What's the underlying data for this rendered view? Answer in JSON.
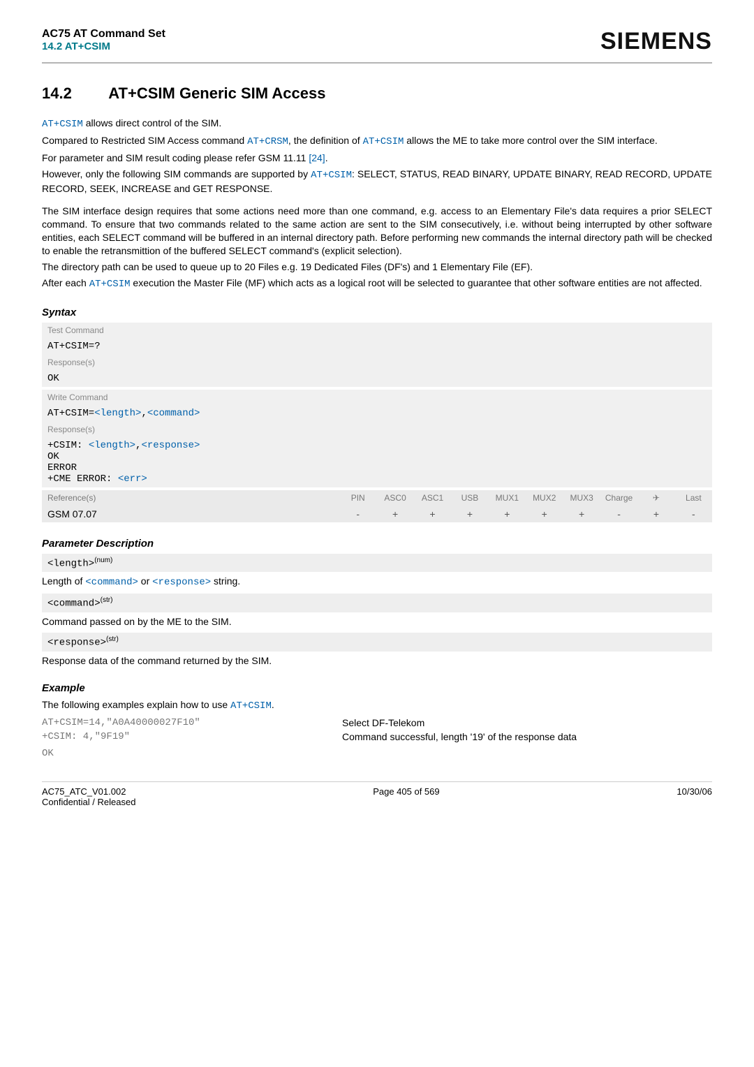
{
  "header": {
    "title": "AC75 AT Command Set",
    "subtitle": "14.2 AT+CSIM",
    "brand": "SIEMENS"
  },
  "section": {
    "number": "14.2",
    "title": "AT+CSIM   Generic SIM Access"
  },
  "intro": {
    "p1_a": "AT+CSIM",
    "p1_b": " allows direct control of the SIM.",
    "p2_a": "Compared to Restricted SIM Access command ",
    "p2_b": "AT+CRSM",
    "p2_c": ", the definition of ",
    "p2_d": "AT+CSIM",
    "p2_e": " allows the ME to take more control over the SIM interface.",
    "p3_a": "For parameter and SIM result coding please refer GSM 11.11 ",
    "p3_b": "[24]",
    "p3_c": ".",
    "p4_a": "However, only the following SIM commands are supported by ",
    "p4_b": "AT+CSIM",
    "p4_c": ": SELECT, STATUS, READ BINARY, UPDATE BINARY, READ RECORD, UPDATE RECORD, SEEK, INCREASE and GET RESPONSE.",
    "p5": "The SIM interface design requires that some actions need more than one command, e.g. access to an Elementary File's data requires a prior SELECT command. To ensure that two commands related to the same action are sent to the SIM consecutively, i.e. without being interrupted by other software entities, each SELECT command will be buffered in an internal directory path. Before performing new commands the internal directory path will be checked to enable the retransmittion of the buffered SELECT command's (explicit selection).",
    "p6": "The directory path can be used to queue up to 20 Files e.g. 19 Dedicated Files (DF's) and 1 Elementary File (EF).",
    "p7_a": "After each ",
    "p7_b": "AT+CSIM",
    "p7_c": " execution the Master File (MF) which acts as a logical root will be selected to guarantee that other software entities are not affected."
  },
  "syntax": {
    "heading": "Syntax",
    "testLabel": "Test Command",
    "testCmd": "AT+CSIM=?",
    "respLabel": "Response(s)",
    "ok": "OK",
    "writeLabel": "Write Command",
    "writeCmd_a": "AT+CSIM=",
    "writeCmd_b": "<length>",
    "writeCmd_c": ",",
    "writeCmd_d": "<command>",
    "writeResp_a": "+CSIM: ",
    "writeResp_b": "<length>",
    "writeResp_c": ",",
    "writeResp_d": "<response>",
    "error": "ERROR",
    "cme_a": "+CME ERROR: ",
    "cme_b": "<err>",
    "refLabel": "Reference(s)",
    "cols": [
      "PIN",
      "ASC0",
      "ASC1",
      "USB",
      "MUX1",
      "MUX2",
      "MUX3",
      "Charge",
      "✈",
      "Last"
    ],
    "refName": "GSM 07.07",
    "vals": [
      "-",
      "+",
      "+",
      "+",
      "+",
      "+",
      "+",
      "-",
      "+",
      "-"
    ]
  },
  "params": {
    "heading": "Parameter Description",
    "length_label": "<length>",
    "length_sup": "(num)",
    "length_desc_a": "Length of ",
    "length_desc_b": "<command>",
    "length_desc_c": " or ",
    "length_desc_d": "<response>",
    "length_desc_e": " string.",
    "command_label": "<command>",
    "command_sup": "(str)",
    "command_desc": "Command passed on by the ME to the SIM.",
    "response_label": "<response>",
    "response_sup": "(str)",
    "response_desc": "Response data of the command returned by the SIM."
  },
  "example": {
    "heading": "Example",
    "intro_a": "The following examples explain how to use ",
    "intro_b": "AT+CSIM",
    "intro_c": ".",
    "rows": [
      {
        "left": "AT+CSIM=14,\"A0A40000027F10\"",
        "right": "Select DF-Telekom"
      },
      {
        "left": "+CSIM: 4,\"9F19\"",
        "right": "Command successful, length '19' of the response data"
      },
      {
        "left": "",
        "right": ""
      },
      {
        "left": "OK",
        "right": ""
      }
    ]
  },
  "footer": {
    "left1": "AC75_ATC_V01.002",
    "left2": "Confidential / Released",
    "center": "Page 405 of 569",
    "right": "10/30/06"
  }
}
